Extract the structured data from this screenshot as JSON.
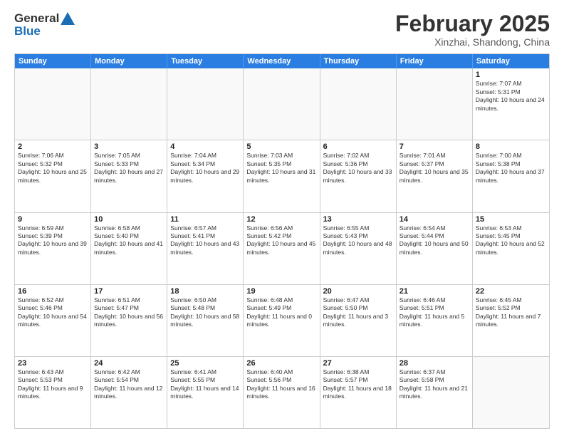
{
  "header": {
    "logo_general": "General",
    "logo_blue": "Blue",
    "title": "February 2025",
    "subtitle": "Xinzhai, Shandong, China"
  },
  "weekdays": [
    "Sunday",
    "Monday",
    "Tuesday",
    "Wednesday",
    "Thursday",
    "Friday",
    "Saturday"
  ],
  "rows": [
    [
      {
        "day": "",
        "info": ""
      },
      {
        "day": "",
        "info": ""
      },
      {
        "day": "",
        "info": ""
      },
      {
        "day": "",
        "info": ""
      },
      {
        "day": "",
        "info": ""
      },
      {
        "day": "",
        "info": ""
      },
      {
        "day": "1",
        "info": "Sunrise: 7:07 AM\nSunset: 5:31 PM\nDaylight: 10 hours and 24 minutes."
      }
    ],
    [
      {
        "day": "2",
        "info": "Sunrise: 7:06 AM\nSunset: 5:32 PM\nDaylight: 10 hours and 25 minutes."
      },
      {
        "day": "3",
        "info": "Sunrise: 7:05 AM\nSunset: 5:33 PM\nDaylight: 10 hours and 27 minutes."
      },
      {
        "day": "4",
        "info": "Sunrise: 7:04 AM\nSunset: 5:34 PM\nDaylight: 10 hours and 29 minutes."
      },
      {
        "day": "5",
        "info": "Sunrise: 7:03 AM\nSunset: 5:35 PM\nDaylight: 10 hours and 31 minutes."
      },
      {
        "day": "6",
        "info": "Sunrise: 7:02 AM\nSunset: 5:36 PM\nDaylight: 10 hours and 33 minutes."
      },
      {
        "day": "7",
        "info": "Sunrise: 7:01 AM\nSunset: 5:37 PM\nDaylight: 10 hours and 35 minutes."
      },
      {
        "day": "8",
        "info": "Sunrise: 7:00 AM\nSunset: 5:38 PM\nDaylight: 10 hours and 37 minutes."
      }
    ],
    [
      {
        "day": "9",
        "info": "Sunrise: 6:59 AM\nSunset: 5:39 PM\nDaylight: 10 hours and 39 minutes."
      },
      {
        "day": "10",
        "info": "Sunrise: 6:58 AM\nSunset: 5:40 PM\nDaylight: 10 hours and 41 minutes."
      },
      {
        "day": "11",
        "info": "Sunrise: 6:57 AM\nSunset: 5:41 PM\nDaylight: 10 hours and 43 minutes."
      },
      {
        "day": "12",
        "info": "Sunrise: 6:56 AM\nSunset: 5:42 PM\nDaylight: 10 hours and 45 minutes."
      },
      {
        "day": "13",
        "info": "Sunrise: 6:55 AM\nSunset: 5:43 PM\nDaylight: 10 hours and 48 minutes."
      },
      {
        "day": "14",
        "info": "Sunrise: 6:54 AM\nSunset: 5:44 PM\nDaylight: 10 hours and 50 minutes."
      },
      {
        "day": "15",
        "info": "Sunrise: 6:53 AM\nSunset: 5:45 PM\nDaylight: 10 hours and 52 minutes."
      }
    ],
    [
      {
        "day": "16",
        "info": "Sunrise: 6:52 AM\nSunset: 5:46 PM\nDaylight: 10 hours and 54 minutes."
      },
      {
        "day": "17",
        "info": "Sunrise: 6:51 AM\nSunset: 5:47 PM\nDaylight: 10 hours and 56 minutes."
      },
      {
        "day": "18",
        "info": "Sunrise: 6:50 AM\nSunset: 5:48 PM\nDaylight: 10 hours and 58 minutes."
      },
      {
        "day": "19",
        "info": "Sunrise: 6:48 AM\nSunset: 5:49 PM\nDaylight: 11 hours and 0 minutes."
      },
      {
        "day": "20",
        "info": "Sunrise: 6:47 AM\nSunset: 5:50 PM\nDaylight: 11 hours and 3 minutes."
      },
      {
        "day": "21",
        "info": "Sunrise: 6:46 AM\nSunset: 5:51 PM\nDaylight: 11 hours and 5 minutes."
      },
      {
        "day": "22",
        "info": "Sunrise: 6:45 AM\nSunset: 5:52 PM\nDaylight: 11 hours and 7 minutes."
      }
    ],
    [
      {
        "day": "23",
        "info": "Sunrise: 6:43 AM\nSunset: 5:53 PM\nDaylight: 11 hours and 9 minutes."
      },
      {
        "day": "24",
        "info": "Sunrise: 6:42 AM\nSunset: 5:54 PM\nDaylight: 11 hours and 12 minutes."
      },
      {
        "day": "25",
        "info": "Sunrise: 6:41 AM\nSunset: 5:55 PM\nDaylight: 11 hours and 14 minutes."
      },
      {
        "day": "26",
        "info": "Sunrise: 6:40 AM\nSunset: 5:56 PM\nDaylight: 11 hours and 16 minutes."
      },
      {
        "day": "27",
        "info": "Sunrise: 6:38 AM\nSunset: 5:57 PM\nDaylight: 11 hours and 18 minutes."
      },
      {
        "day": "28",
        "info": "Sunrise: 6:37 AM\nSunset: 5:58 PM\nDaylight: 11 hours and 21 minutes."
      },
      {
        "day": "",
        "info": ""
      }
    ]
  ]
}
